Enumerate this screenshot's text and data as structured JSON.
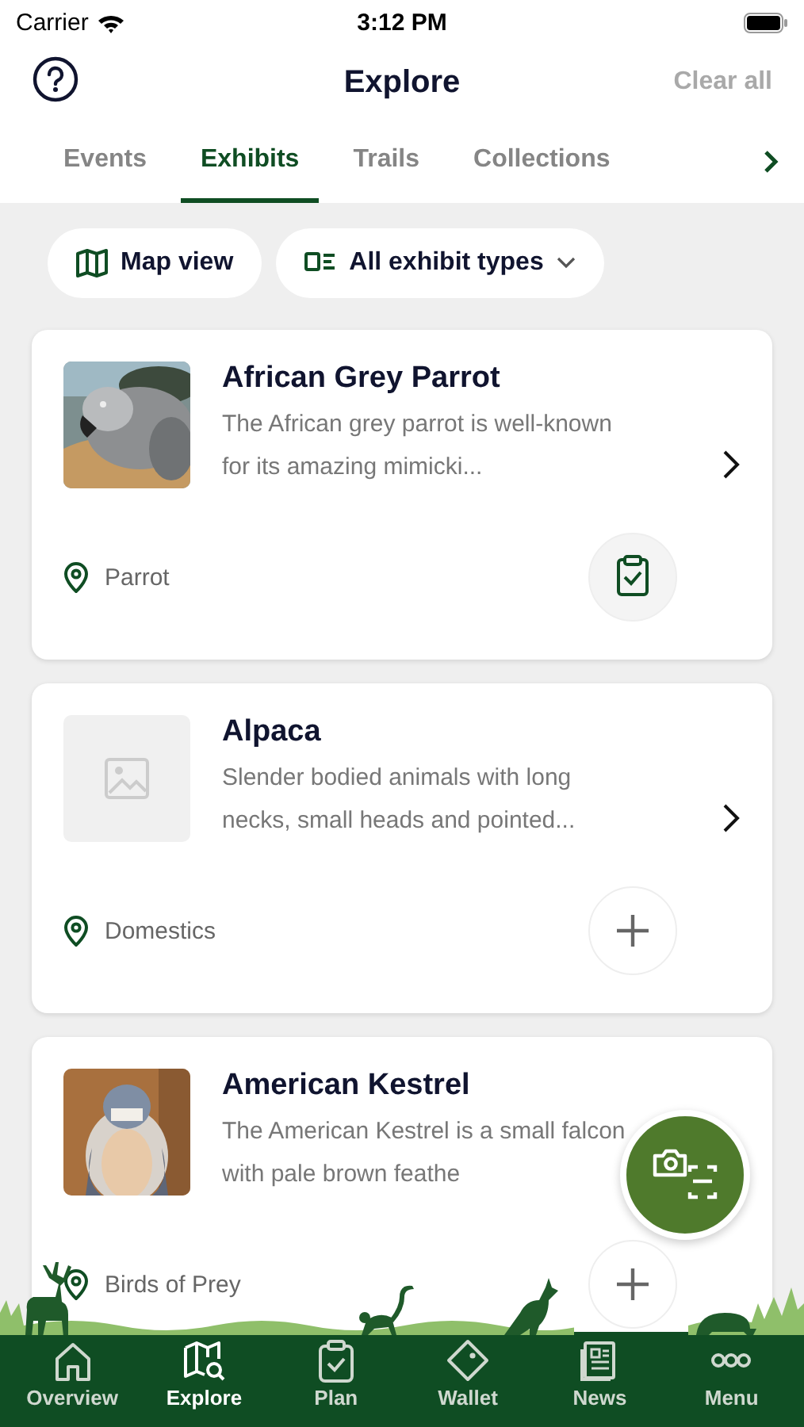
{
  "status_bar": {
    "carrier": "Carrier",
    "time": "3:12 PM"
  },
  "header": {
    "title": "Explore",
    "action": "Clear all",
    "action_disabled": true
  },
  "tabs": [
    {
      "label": "Events",
      "selected": false
    },
    {
      "label": "Exhibits",
      "selected": true
    },
    {
      "label": "Trails",
      "selected": false
    },
    {
      "label": "Collections",
      "selected": false
    }
  ],
  "filters": [
    {
      "kind": "map",
      "label": "Map view"
    },
    {
      "kind": "types",
      "label": "All exhibit types"
    }
  ],
  "exhibits": [
    {
      "title": "African Grey Parrot",
      "description": "The African grey parrot is well-known for its amazing mimicki...",
      "location": "Parrot",
      "in_plan": true
    },
    {
      "title": "Alpaca",
      "description": "Slender bodied animals with long necks, small heads and pointed...",
      "location": "Domestics",
      "image": {
        "kind": "placeholder"
      },
      "in_plan": false
    },
    {
      "title": "American Kestrel",
      "description": "The American Kestrel is a small falcon with pale brown feathe",
      "location": "Birds of Prey",
      "in_plan": false
    }
  ],
  "nav": [
    {
      "kind": "overview",
      "label": "Overview",
      "selected": false
    },
    {
      "kind": "explore",
      "label": "Explore",
      "selected": true
    },
    {
      "kind": "plan",
      "label": "Plan",
      "selected": false
    },
    {
      "kind": "wallet",
      "label": "Wallet",
      "selected": false
    },
    {
      "kind": "news",
      "label": "News",
      "selected": false
    },
    {
      "kind": "menu",
      "label": "Menu",
      "selected": false
    }
  ]
}
